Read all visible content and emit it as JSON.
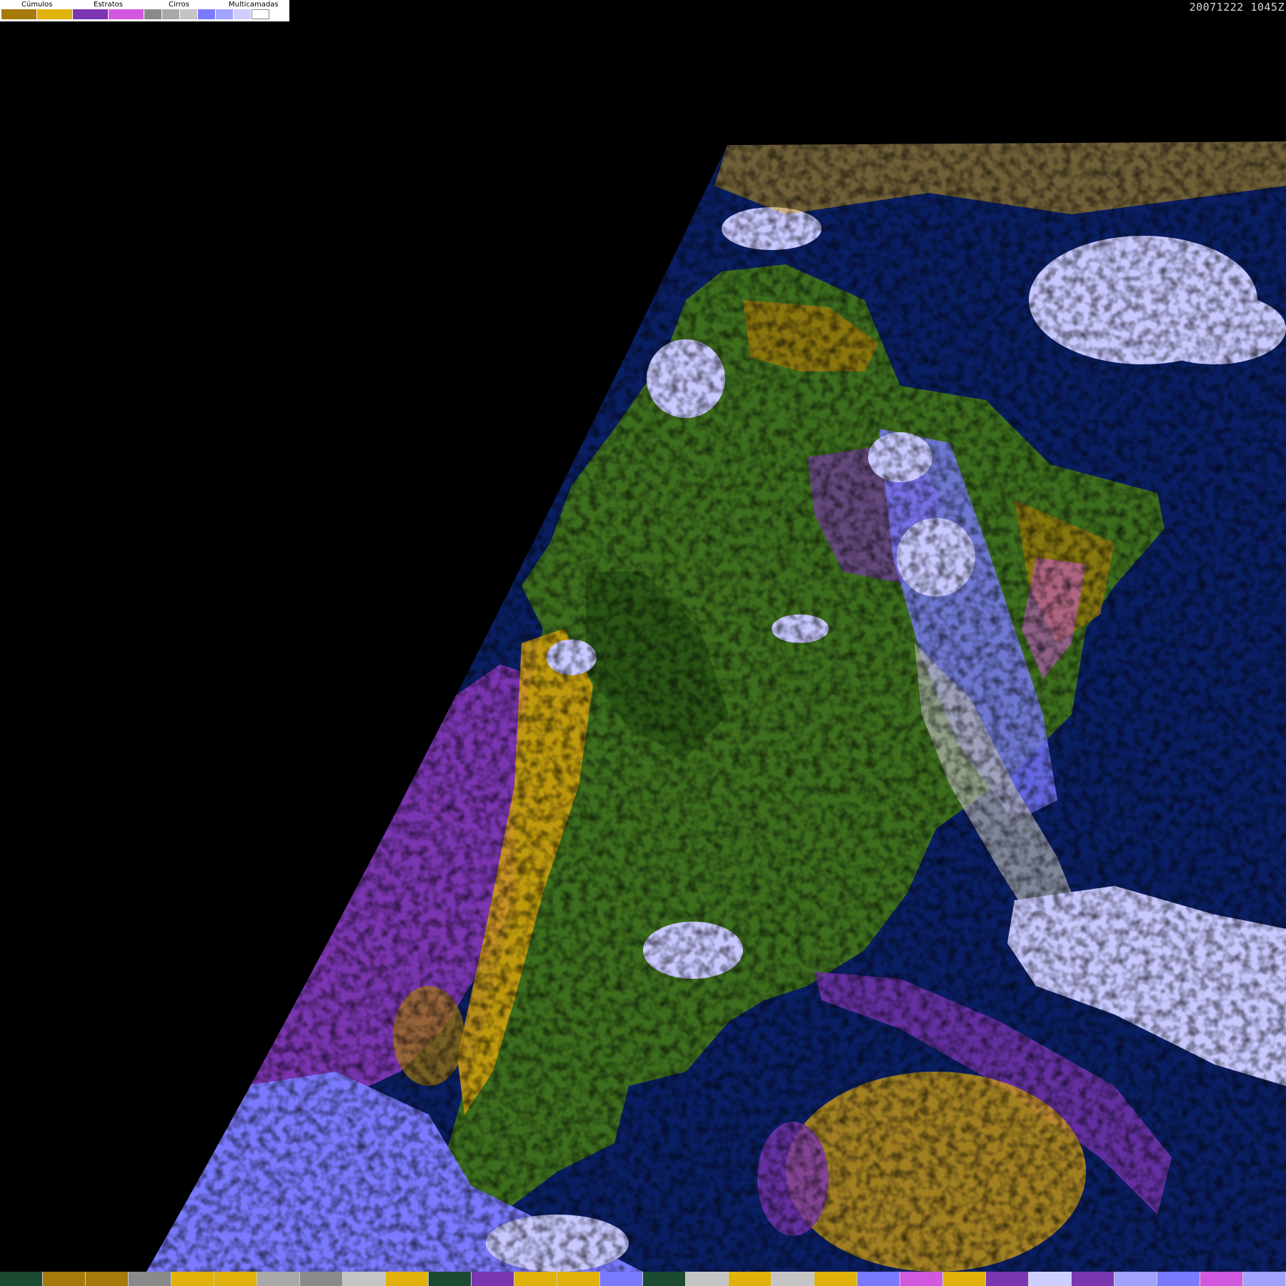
{
  "timestamp": "20071222 1045Z",
  "legend": {
    "groups": [
      {
        "label": "Cúmulos",
        "colors": [
          "#a57a0a",
          "#e0b20a"
        ]
      },
      {
        "label": "Estratos",
        "colors": [
          "#7a35b0",
          "#d258e0"
        ]
      },
      {
        "label": "Cirros",
        "colors": [
          "#8a8a8a",
          "#a8a8a8",
          "#c4c4c4"
        ]
      },
      {
        "label": "Multicamadas",
        "colors": [
          "#7a7aff",
          "#a2a2ff",
          "#cfcfff",
          "#ffffff"
        ]
      }
    ]
  },
  "colors": {
    "background": "#000000",
    "ocean": "#0a1f63",
    "land": "#3d6e1d",
    "land_dark": "#2a5514",
    "cumulus": "#d6a20c",
    "cumulus_dark": "#a57a0a",
    "stratus": "#7a35b0",
    "stratus_light": "#d258e0",
    "cirrus": "#b4b4b4",
    "multilayer": "#7a7aff",
    "multilayer_light": "#c8c8ff",
    "white": "#ffffff"
  },
  "bottom_strip": [
    "#1b4a32",
    "#a57a0a",
    "#a57a0a",
    "#8a8a8a",
    "#e0b20a",
    "#e0b20a",
    "#a8a8a8",
    "#8a8a8a",
    "#c4c4c4",
    "#e0b20a",
    "#1b4a32",
    "#7a35b0",
    "#e0b20a",
    "#e0b20a",
    "#7a7aff",
    "#1b4a32",
    "#c4c4c4",
    "#e0b20a",
    "#c4c4c4",
    "#e0b20a",
    "#7a7aff",
    "#d258e0",
    "#e0b20a",
    "#7a35b0",
    "#cfcfff",
    "#7a35b0",
    "#a2a2ff",
    "#7a7aff",
    "#d258e0",
    "#a2a2ff"
  ]
}
